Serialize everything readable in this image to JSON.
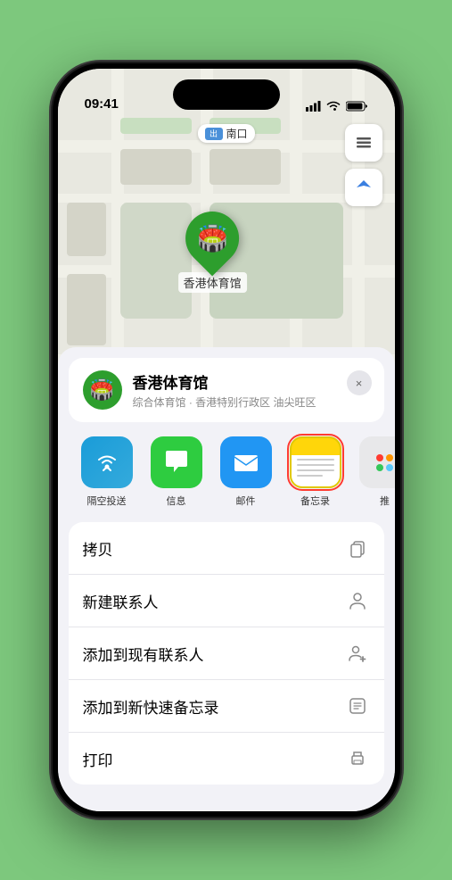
{
  "status_bar": {
    "time": "09:41",
    "location_arrow": "▲"
  },
  "map": {
    "label": "南口",
    "label_prefix": "出口"
  },
  "venue": {
    "name": "香港体育馆",
    "subtitle": "综合体育馆 · 香港特别行政区 油尖旺区",
    "icon": "🏟️"
  },
  "share_items": [
    {
      "id": "airdrop",
      "label": "隔空投送"
    },
    {
      "id": "messages",
      "label": "信息"
    },
    {
      "id": "mail",
      "label": "邮件"
    },
    {
      "id": "notes",
      "label": "备忘录",
      "selected": true
    },
    {
      "id": "more",
      "label": "推"
    }
  ],
  "actions": [
    {
      "id": "copy",
      "label": "拷贝",
      "icon": "copy"
    },
    {
      "id": "new-contact",
      "label": "新建联系人",
      "icon": "person"
    },
    {
      "id": "add-existing",
      "label": "添加到现有联系人",
      "icon": "person-add"
    },
    {
      "id": "quick-note",
      "label": "添加到新快速备忘录",
      "icon": "note"
    },
    {
      "id": "print",
      "label": "打印",
      "icon": "print"
    }
  ],
  "close_label": "×"
}
